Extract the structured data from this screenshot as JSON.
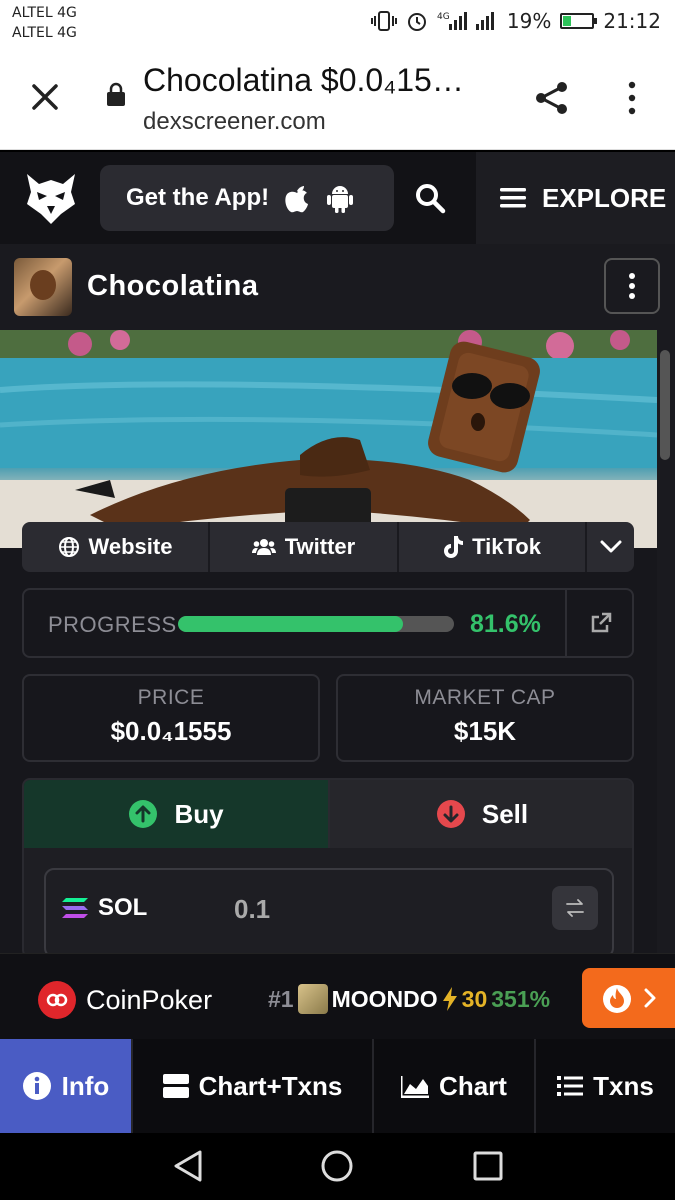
{
  "status_bar": {
    "carrier_1": "ALTEL 4G",
    "carrier_2": "ALTEL 4G",
    "battery_pct": "19%",
    "time": "21:12"
  },
  "browser": {
    "title": "Chocolatina $0.0₄15…",
    "url": "dexscreener.com"
  },
  "site_header": {
    "get_app_label": "Get the App!",
    "explore_label": "EXPLORE"
  },
  "token": {
    "name": "Chocolatina"
  },
  "links": {
    "website": "Website",
    "twitter": "Twitter",
    "tiktok": "TikTok"
  },
  "progress": {
    "label": "PROGRESS",
    "value_text": "81.6%",
    "fraction": 0.816
  },
  "stats": {
    "price_label": "PRICE",
    "price_value": "$0.0₄1555",
    "mcap_label": "MARKET CAP",
    "mcap_value": "$15K"
  },
  "trade": {
    "buy_label": "Buy",
    "sell_label": "Sell",
    "currency": "SOL",
    "amount": "0.1"
  },
  "ad": {
    "brand": "CoinPoker",
    "ticker_rank": "#1",
    "ticker_name": "MOONDO",
    "ticker_num": "30",
    "ticker_pct": "351%"
  },
  "bottom_nav": {
    "info": "Info",
    "chart_txns": "Chart+Txns",
    "chart": "Chart",
    "txns": "Txns"
  },
  "colors": {
    "accent_green": "#34c26b",
    "info_tab": "#4a5cc4",
    "hot_orange": "#f36a1c",
    "sell_red": "#e5484d"
  }
}
